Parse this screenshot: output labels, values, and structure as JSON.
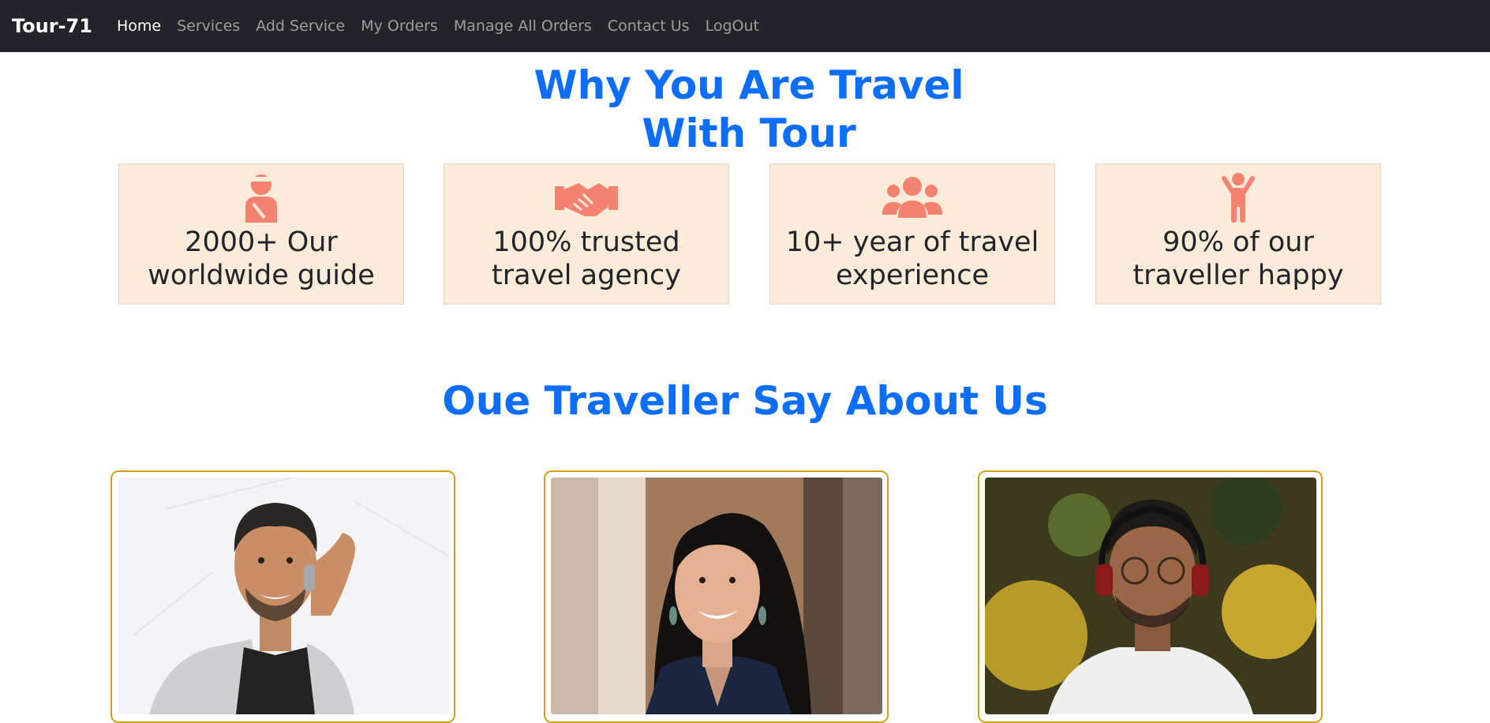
{
  "navbar": {
    "brand": "Tour-71",
    "links": [
      "Home",
      "Services",
      "Add Service",
      "My Orders",
      "Manage All Orders",
      "Contact Us",
      "LogOut"
    ],
    "active_index": 0
  },
  "why_section": {
    "title": "Why You Are Travel With Tour",
    "features": [
      {
        "icon": "guide-person-icon",
        "text": "2000+ Our worldwide guide"
      },
      {
        "icon": "handshake-icon",
        "text": "100% trusted travel agency"
      },
      {
        "icon": "users-group-icon",
        "text": "10+ year of travel experience"
      },
      {
        "icon": "happy-child-icon",
        "text": "90% of our traveller happy"
      }
    ],
    "icon_color": "#f5826e"
  },
  "reviews_section": {
    "title": "Oue Traveller Say About Us",
    "cards": [
      {
        "photo": "man-on-phone-photo"
      },
      {
        "photo": "smiling-woman-photo"
      },
      {
        "photo": "man-with-headphones-photo"
      }
    ],
    "border_color": "#d4a017"
  },
  "colors": {
    "navbar_bg": "#212529",
    "accent_blue": "#0d6efd",
    "card_bg": "#fbebd8"
  }
}
